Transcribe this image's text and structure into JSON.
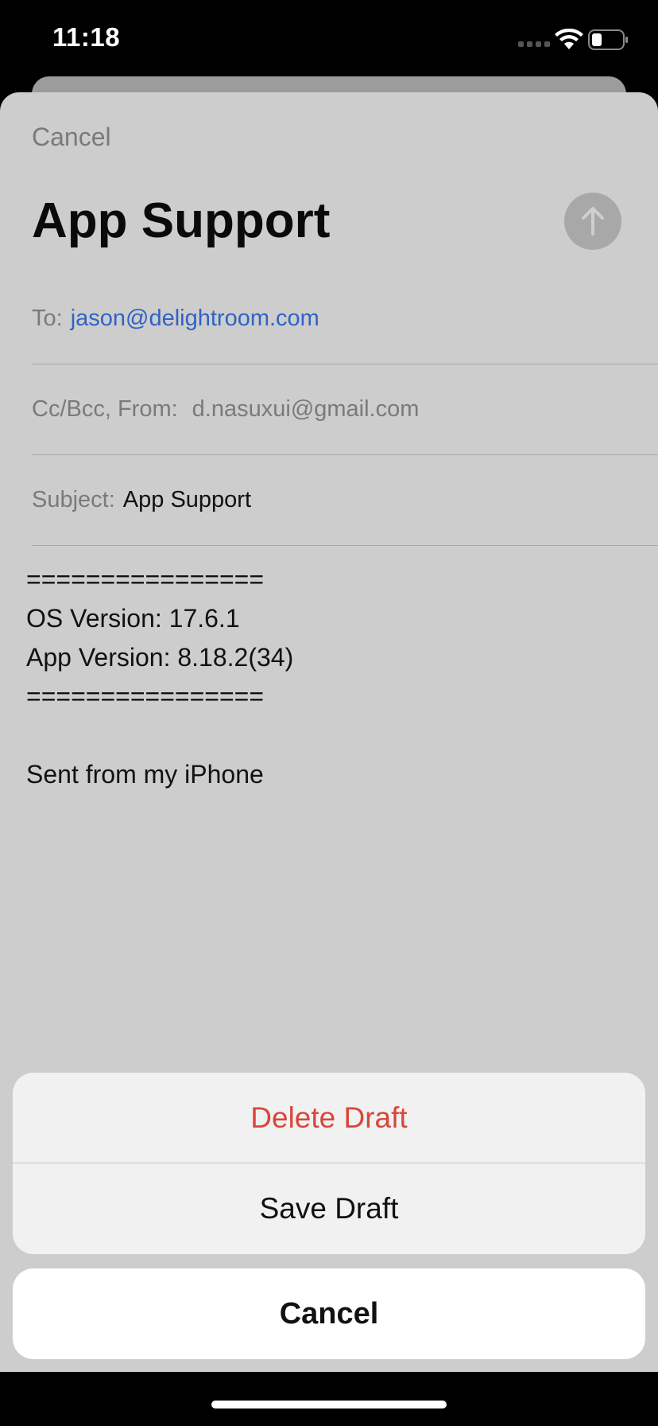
{
  "status_bar": {
    "time": "11:18"
  },
  "compose": {
    "cancel_label": "Cancel",
    "title": "App Support",
    "to_label": "To:",
    "to_value": "jason@delightroom.com",
    "ccbcc_label": "Cc/Bcc, From:",
    "from_value": "d.nasuxui@gmail.com",
    "subject_label": "Subject:",
    "subject_value": "App Support",
    "body_lines": [
      "================",
      "OS Version: 17.6.1",
      "App Version: 8.18.2(34)",
      "================",
      "",
      "Sent from my iPhone"
    ]
  },
  "action_sheet": {
    "delete_label": "Delete Draft",
    "save_label": "Save Draft",
    "cancel_label": "Cancel"
  },
  "colors": {
    "link": "#2f63c4",
    "destructive": "#d9463a",
    "sheet_background": "#cdcdcd"
  },
  "icons": {
    "send": "arrow-up-icon",
    "wifi": "wifi-icon",
    "battery": "battery-icon",
    "signal": "signal-icon"
  }
}
